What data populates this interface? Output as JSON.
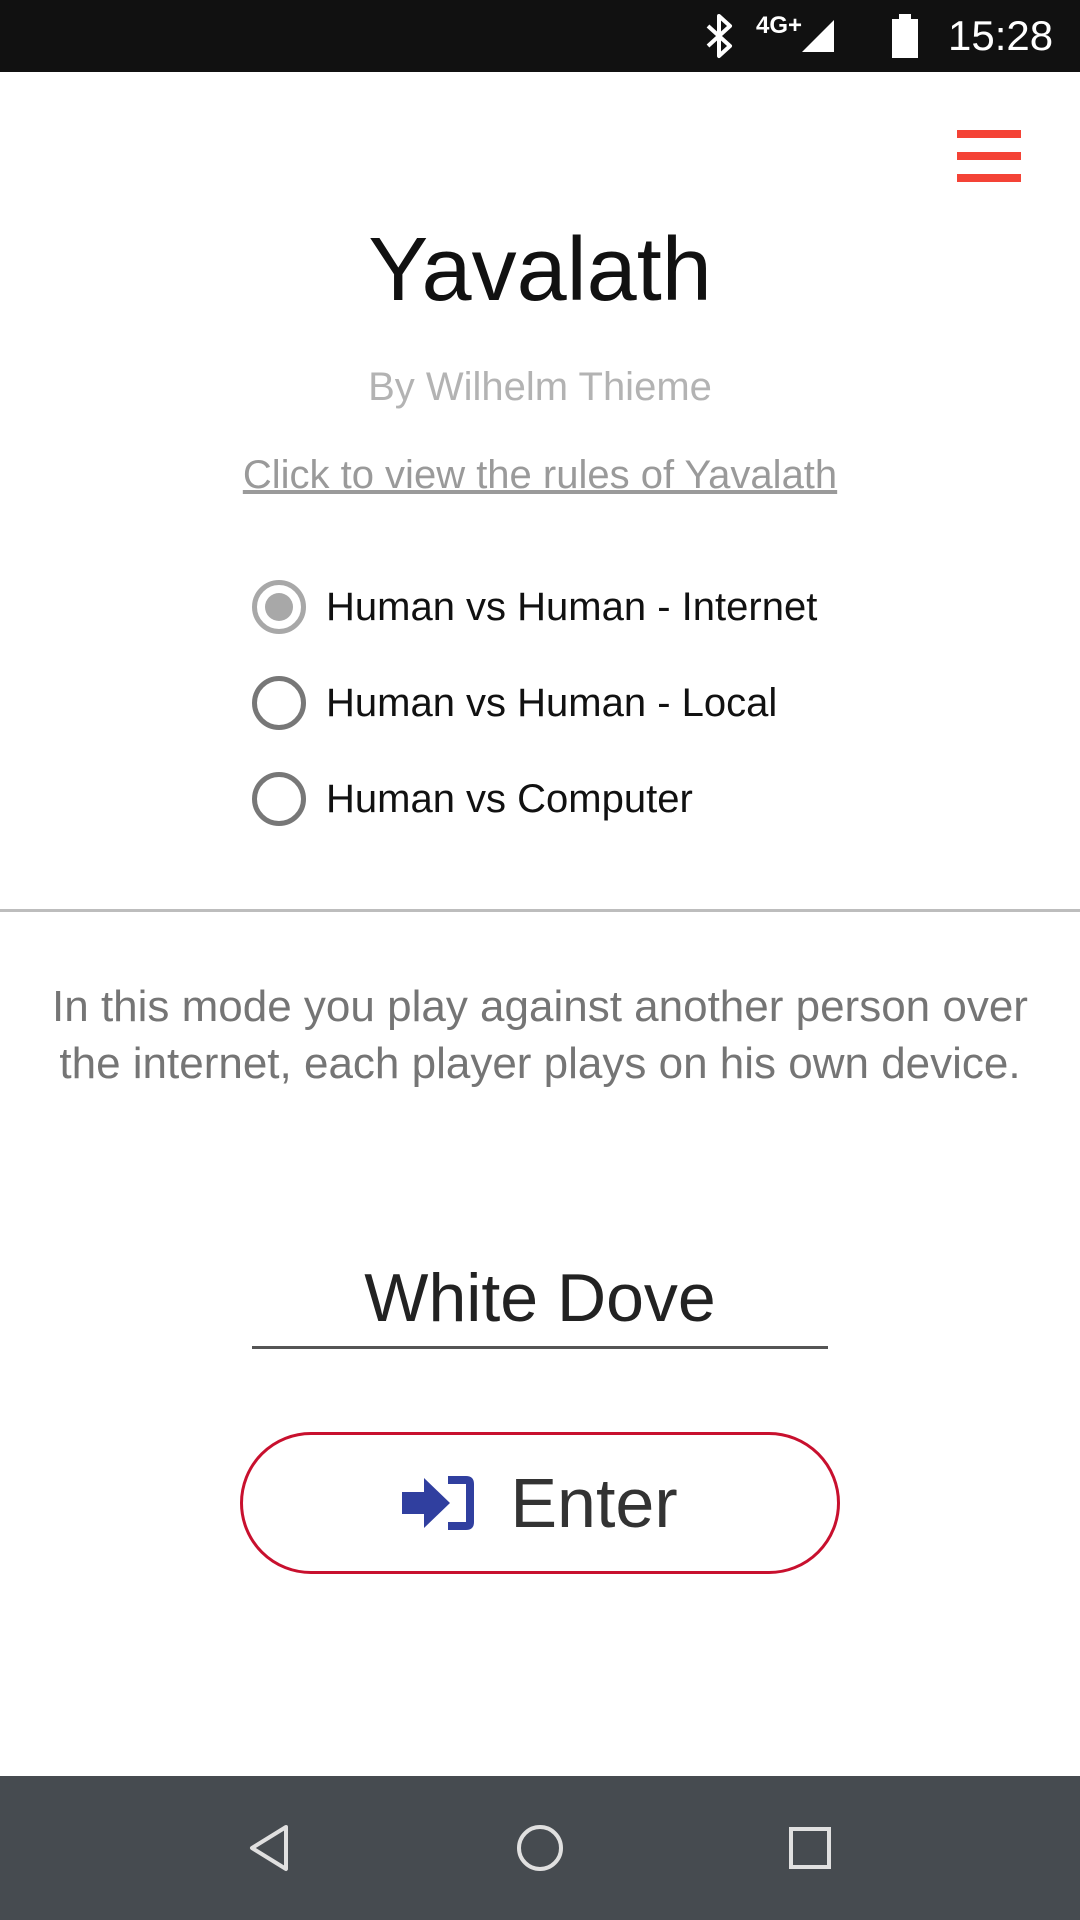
{
  "status_bar": {
    "time": "15:28",
    "network": "4G+",
    "icons": [
      "bluetooth-icon",
      "signal-icon",
      "battery-icon"
    ]
  },
  "header": {
    "menu_icon": "hamburger-menu-icon",
    "menu_color": "#f44336"
  },
  "app": {
    "title": "Yavalath",
    "author": "By Wilhelm Thieme",
    "rules_link": "Click to view the rules of Yavalath"
  },
  "modes": {
    "selected": 0,
    "options": [
      {
        "label": "Human vs Human - Internet",
        "checked": true
      },
      {
        "label": "Human vs Human - Local",
        "checked": false
      },
      {
        "label": "Human vs Computer",
        "checked": false
      }
    ]
  },
  "description": "In this mode you play against another person over the internet, each player plays on his own device.",
  "player_name": {
    "value": "White Dove"
  },
  "enter_button": {
    "label": "Enter",
    "icon": "sign-in-icon",
    "icon_color": "#303f9f",
    "border_color": "#c8102e"
  },
  "nav_bar": {
    "buttons": [
      "back-icon",
      "home-icon",
      "recents-icon"
    ]
  }
}
